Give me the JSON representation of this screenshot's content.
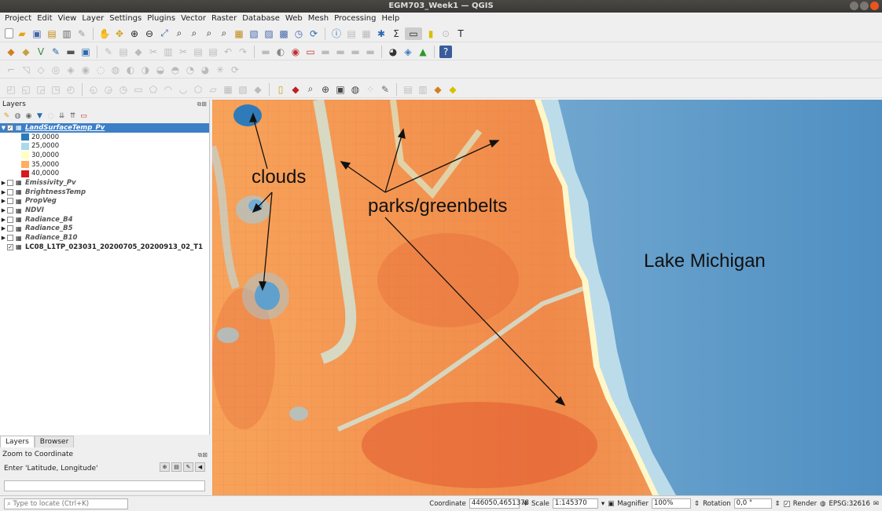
{
  "window": {
    "title": "EGM703_Week1 — QGIS"
  },
  "menu": [
    "Project",
    "Edit",
    "View",
    "Layer",
    "Settings",
    "Plugins",
    "Vector",
    "Raster",
    "Database",
    "Web",
    "Mesh",
    "Processing",
    "Help"
  ],
  "layers_panel": {
    "title": "Layers",
    "layers": [
      {
        "name": "LandSurfaceTemp_Pv",
        "checked": true,
        "expanded": true,
        "selected": true
      },
      {
        "name": "Emissivity_Pv",
        "checked": false
      },
      {
        "name": "BrightnessTemp",
        "checked": false
      },
      {
        "name": "PropVeg",
        "checked": false
      },
      {
        "name": "NDVI",
        "checked": false
      },
      {
        "name": "Radiance_B4",
        "checked": false
      },
      {
        "name": "Radiance_B5",
        "checked": false
      },
      {
        "name": "Radiance_B10",
        "checked": false
      },
      {
        "name": "LC08_L1TP_023031_20200705_20200913_02_T1",
        "checked": true
      }
    ],
    "legend": [
      {
        "label": "20,0000",
        "color": "#2b7bba"
      },
      {
        "label": "25,0000",
        "color": "#abd9e9"
      },
      {
        "label": "30,0000",
        "color": "#ffffbf"
      },
      {
        "label": "35,0000",
        "color": "#fdae61"
      },
      {
        "label": "40,0000",
        "color": "#d7191c"
      }
    ]
  },
  "tabs": [
    "Layers",
    "Browser"
  ],
  "zoom_panel": {
    "title": "Zoom to Coordinate",
    "label": "Enter 'Latitude, Longitude'"
  },
  "map_annotations": {
    "clouds": "clouds",
    "parks": "parks/greenbelts",
    "lake": "Lake Michigan"
  },
  "status": {
    "locate_placeholder": "Type to locate (Ctrl+K)",
    "coordinate_label": "Coordinate",
    "coordinate": "446050,4651378",
    "scale_label": "Scale",
    "scale": "1:145370",
    "magnifier_label": "Magnifier",
    "magnifier": "100%",
    "rotation_label": "Rotation",
    "rotation": "0,0 °",
    "render_label": "Render",
    "crs": "EPSG:32616"
  }
}
